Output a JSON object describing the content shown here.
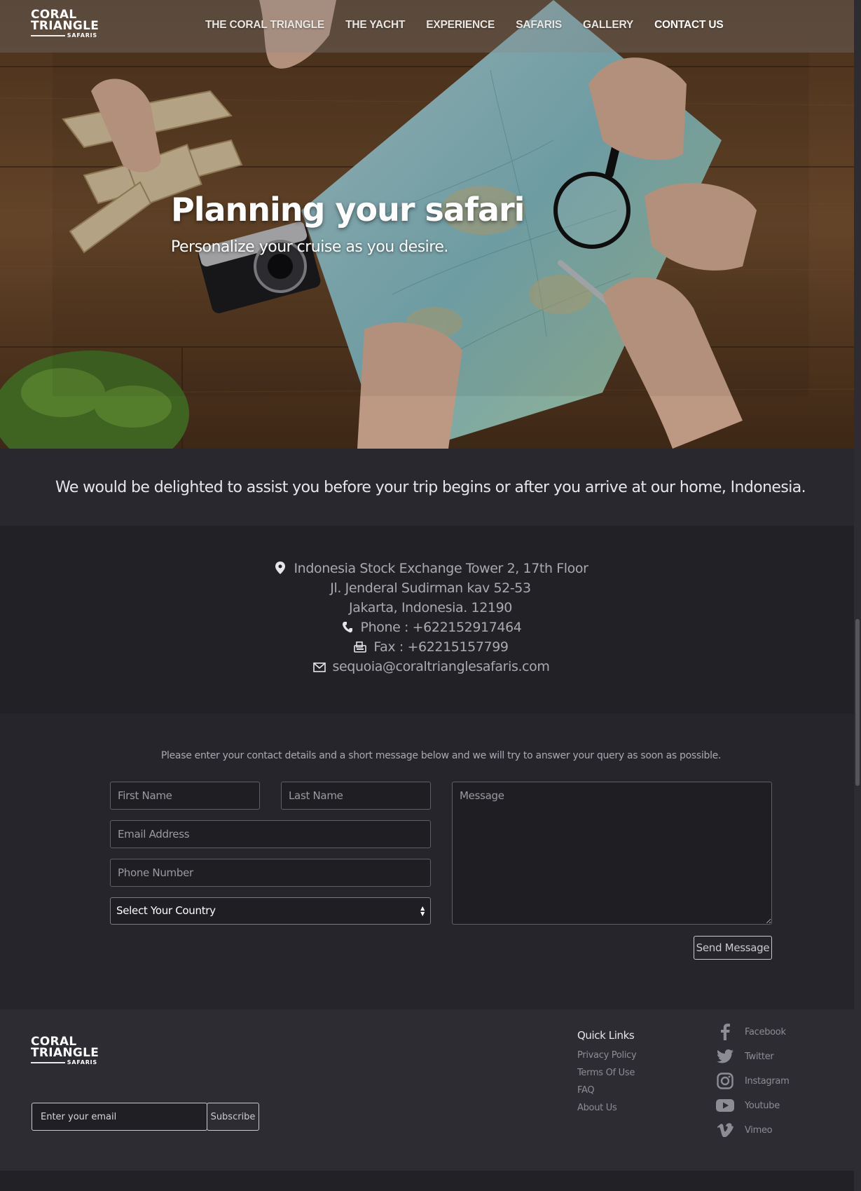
{
  "brand": {
    "line1": "CORAL",
    "line2": "TRIANGLE",
    "line3": "SAFARIS"
  },
  "nav": {
    "items": [
      "THE CORAL TRIANGLE",
      "THE YACHT",
      "EXPERIENCE",
      "SAFARIS",
      "GALLERY",
      "CONTACT US"
    ],
    "active": "CONTACT US"
  },
  "hero": {
    "title": "Planning your safari",
    "subtitle": "Personalize your cruise as you desire."
  },
  "intro": "We would be delighted to assist you before your trip begins or after you arrive at our home, Indonesia.",
  "contact": {
    "address_line1": "Indonesia Stock Exchange Tower 2, 17th Floor",
    "address_line2": "Jl. Jenderal Sudirman kav 52-53",
    "address_line3": "Jakarta, Indonesia. 12190",
    "phone": "Phone : +622152917464",
    "fax": "Fax : +62215157799",
    "email": "sequoia@coraltrianglesafaris.com"
  },
  "form": {
    "hint": "Please enter your contact details and a short message below and we will try to answer your query as soon as possible.",
    "first_name_placeholder": "First Name",
    "last_name_placeholder": "Last Name",
    "email_placeholder": "Email Address",
    "phone_placeholder": "Phone Number",
    "country_selected": "Select Your Country",
    "message_placeholder": "Message",
    "send_label": "Send Message"
  },
  "footer": {
    "subscribe_placeholder": "Enter your email",
    "subscribe_label": "Subscribe",
    "quick_links_title": "Quick Links",
    "quick_links": [
      "Privacy Policy",
      "Terms Of Use",
      "FAQ",
      "About Us"
    ],
    "social": [
      "Facebook",
      "Twitter",
      "Instagram",
      "Youtube",
      "Vimeo"
    ]
  },
  "colors": {
    "page_bg": "#25252b",
    "intro_bg": "#28282e",
    "info_bg": "#212126",
    "footer_bg": "#2c2c32",
    "text_muted": "#a9a9b0"
  }
}
